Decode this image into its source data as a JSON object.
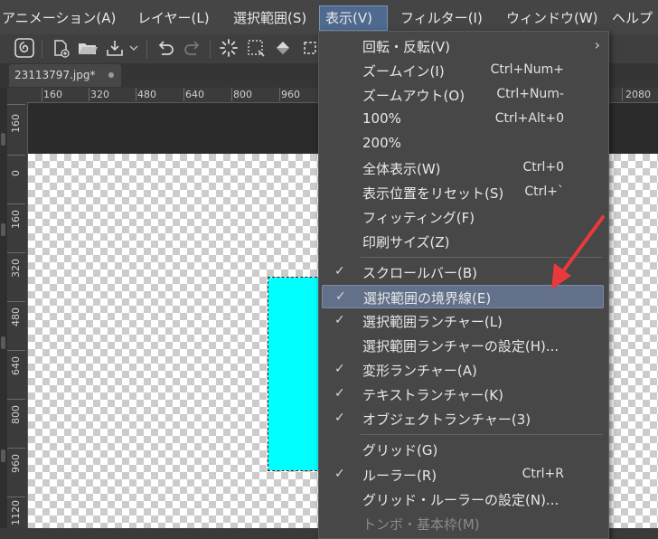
{
  "menubar": {
    "items": [
      {
        "label": "アニメーション(A)"
      },
      {
        "label": "レイヤー(L)"
      },
      {
        "label": "選択範囲(S)"
      },
      {
        "label": "表示(V)"
      },
      {
        "label": "フィルター(I)"
      },
      {
        "label": "ウィンドウ(W)"
      },
      {
        "label": "ヘルプ"
      }
    ]
  },
  "toolbar": {
    "icons": [
      "app-logo-icon",
      "new-file-icon",
      "open-folder-icon",
      "save-export-icon",
      "dropdown-chevron-icon",
      "undo-icon",
      "redo-icon",
      "loading-spinner-icon",
      "selection-dashed-icon",
      "fill-icon",
      "crop-icon"
    ]
  },
  "tab": {
    "title": "23113797.jpg*"
  },
  "ruler_top": {
    "labels": [
      "160",
      "320",
      "480",
      "640",
      "800",
      "960",
      "2080"
    ]
  },
  "ruler_left": {
    "labels": [
      "160",
      "0",
      "160",
      "320",
      "480",
      "640",
      "800",
      "960",
      "1120"
    ]
  },
  "view_menu": {
    "items": [
      {
        "label": "回転・反転(V)",
        "shortcut": "",
        "checked": false,
        "submenu": true
      },
      {
        "label": "ズームイン(I)",
        "shortcut": "Ctrl+Num+",
        "checked": false
      },
      {
        "label": "ズームアウト(O)",
        "shortcut": "Ctrl+Num-",
        "checked": false
      },
      {
        "label": "100%",
        "shortcut": "Ctrl+Alt+0",
        "checked": false
      },
      {
        "label": "200%",
        "shortcut": "",
        "checked": false
      },
      {
        "label": "全体表示(W)",
        "shortcut": "Ctrl+0",
        "checked": false
      },
      {
        "label": "表示位置をリセット(S)",
        "shortcut": "Ctrl+`",
        "checked": false
      },
      {
        "label": "フィッティング(F)",
        "shortcut": "",
        "checked": false
      },
      {
        "label": "印刷サイズ(Z)",
        "shortcut": "",
        "checked": false
      },
      {
        "label": "スクロールバー(B)",
        "shortcut": "",
        "checked": true
      },
      {
        "label": "選択範囲の境界線(E)",
        "shortcut": "",
        "checked": true,
        "highlighted": true
      },
      {
        "label": "選択範囲ランチャー(L)",
        "shortcut": "",
        "checked": true
      },
      {
        "label": "選択範囲ランチャーの設定(H)...",
        "shortcut": "",
        "checked": false
      },
      {
        "label": "変形ランチャー(A)",
        "shortcut": "",
        "checked": true
      },
      {
        "label": "テキストランチャー(K)",
        "shortcut": "",
        "checked": true
      },
      {
        "label": "オブジェクトランチャー(3)",
        "shortcut": "",
        "checked": true
      },
      {
        "label": "グリッド(G)",
        "shortcut": "",
        "checked": false
      },
      {
        "label": "ルーラー(R)",
        "shortcut": "Ctrl+R",
        "checked": true
      },
      {
        "label": "グリッド・ルーラーの設定(N)...",
        "shortcut": "",
        "checked": false
      },
      {
        "label": "トンボ・基本枠(M)",
        "shortcut": "",
        "checked": false,
        "disabled": true
      }
    ],
    "check_mark": "✓",
    "submenu_arrow": "›"
  },
  "colors": {
    "accent_highlight": "#627089",
    "menu_active": "#4f6a8f",
    "canvas_shape": "#00ffff",
    "annotation_arrow": "#e83a3a"
  }
}
